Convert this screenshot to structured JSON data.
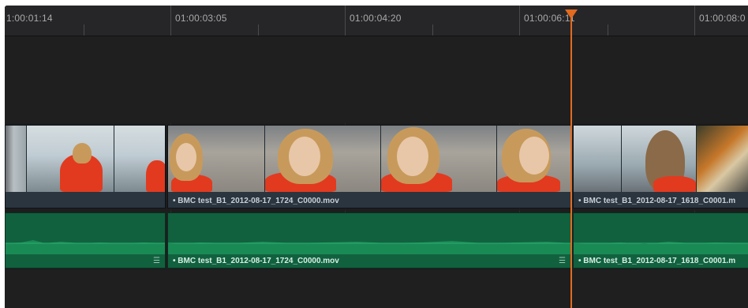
{
  "ruler": {
    "timecodes": [
      "1:00:01:14",
      "01:00:03:05",
      "01:00:04:20",
      "01:00:06:11",
      "01:00:08:0"
    ]
  },
  "video_track": {
    "clips": [
      {
        "name": "",
        "thumb_scenes": [
          "alley",
          "red-back",
          "red-back"
        ]
      },
      {
        "name": "• BMC test_B1_2012-08-17_1724_C0000.mov",
        "thumb_scenes": [
          "portrait",
          "portrait",
          "portrait",
          "portrait"
        ]
      },
      {
        "name": "• BMC test_B1_2012-08-17_1618_C0001.m",
        "thumb_scenes": [
          "street",
          "street",
          "graffiti"
        ]
      }
    ]
  },
  "audio_track": {
    "clips": [
      {
        "name": ""
      },
      {
        "name": "• BMC test_B1_2012-08-17_1724_C0000.mov"
      },
      {
        "name": "• BMC test_B1_2012-08-17_1618_C0001.m"
      }
    ]
  },
  "icons": {
    "clip_menu": "menu-lines-icon",
    "playhead": "playhead-marker-icon"
  },
  "colors": {
    "playhead": "#e36a1e",
    "audio_clip": "#11613f",
    "video_clip": "#2a3540",
    "background": "#1d1d1e"
  }
}
